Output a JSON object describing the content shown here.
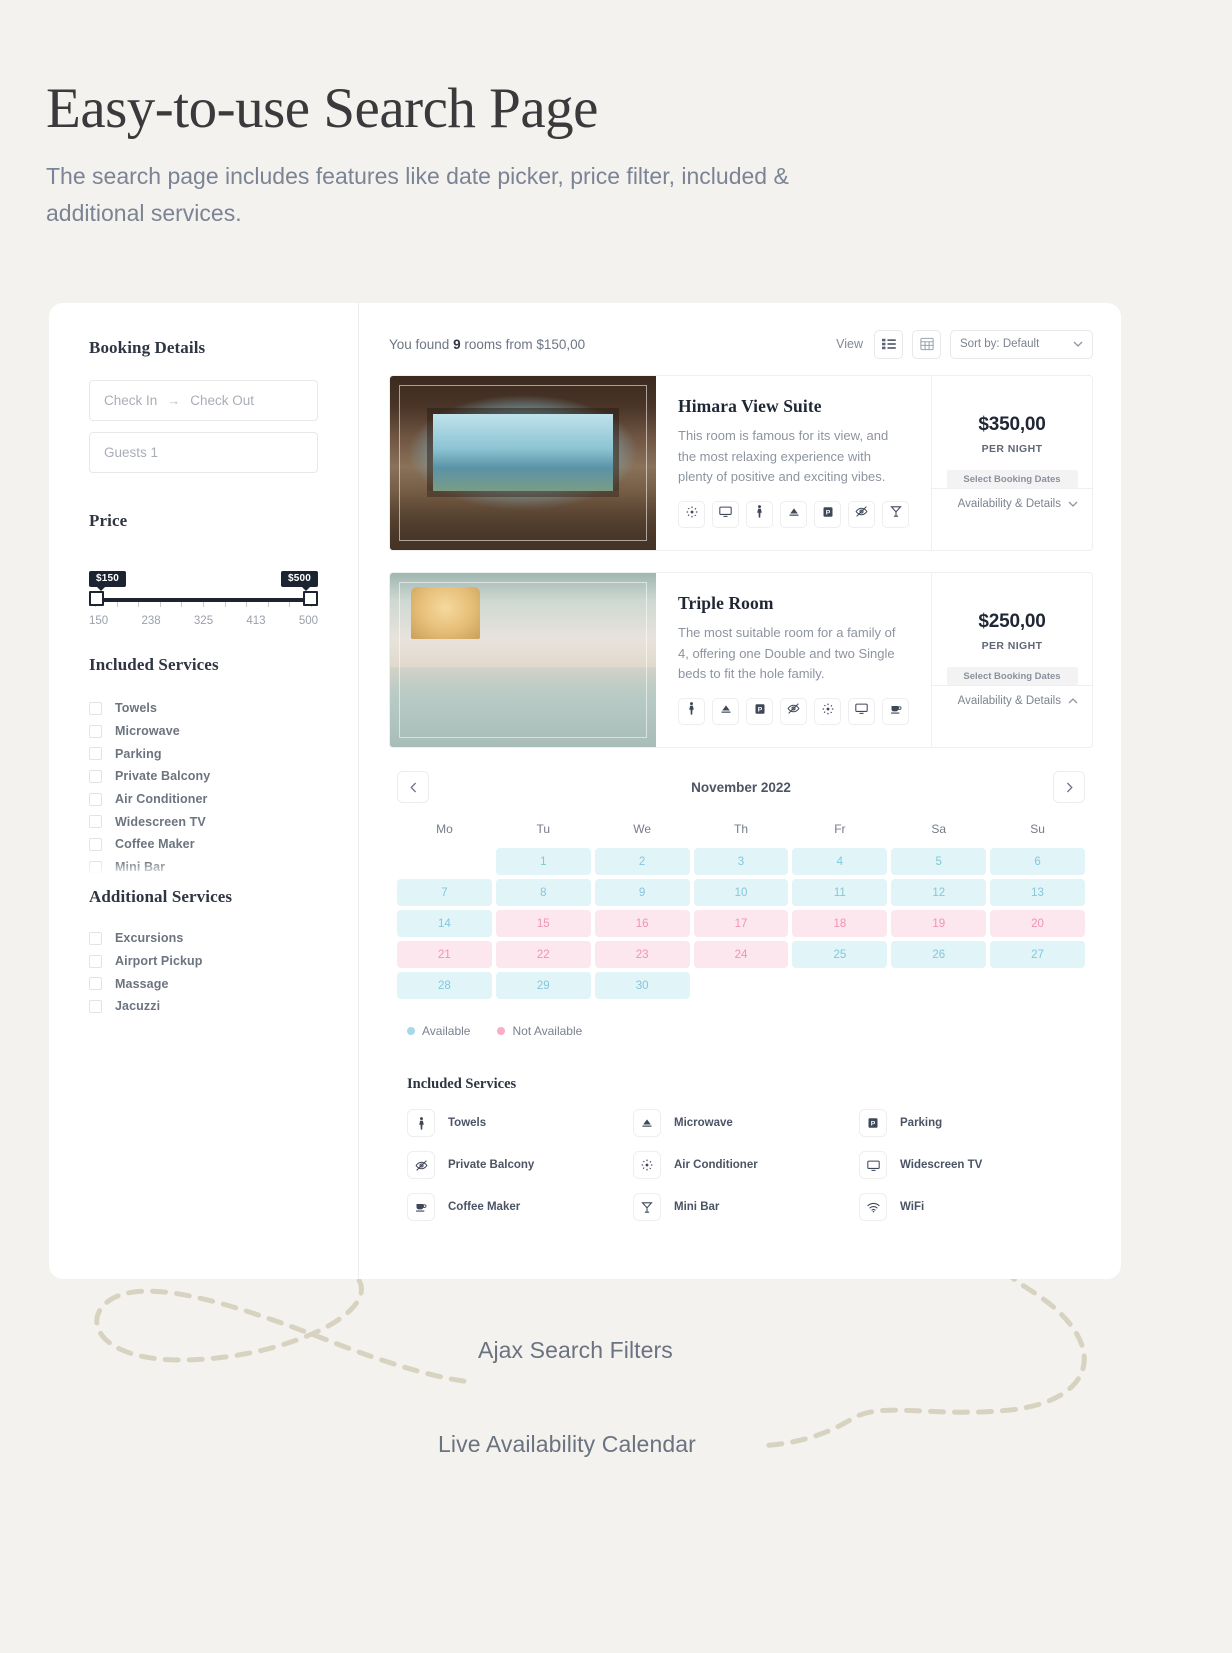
{
  "hero": {
    "title": "Easy-to-use Search Page",
    "subtitle": "The search page includes features like date picker, price filter, included & additional services."
  },
  "sidebar": {
    "booking_details_title": "Booking Details",
    "check_in_placeholder": "Check In",
    "check_out_placeholder": "Check Out",
    "arrow": "→",
    "guests_value": "Guests 1",
    "price_title": "Price",
    "price_min_bubble": "$150",
    "price_max_bubble": "$500",
    "scale": [
      "150",
      "238",
      "325",
      "413",
      "500"
    ],
    "included_title": "Included Services",
    "included_items": [
      "Towels",
      "Microwave",
      "Parking",
      "Private Balcony",
      "Air Conditioner",
      "Widescreen TV",
      "Coffee Maker",
      "Mini Bar"
    ],
    "additional_title": "Additional Services",
    "additional_items": [
      "Excursions",
      "Airport Pickup",
      "Massage",
      "Jacuzzi"
    ]
  },
  "toolbar": {
    "found_prefix": "You found ",
    "found_count": "9",
    "found_suffix": " rooms from $150,00",
    "view_label": "View",
    "sort_label": "Sort by: Default"
  },
  "rooms": [
    {
      "title": "Himara View Suite",
      "description": "This room is famous for its view, and the most relaxing experience with plenty of positive and exciting vibes.",
      "price": "$350,00",
      "per": "PER NIGHT",
      "cta": "Select Booking Dates",
      "availability_label": "Availability & Details",
      "amenities": [
        "air-conditioner",
        "widescreen-tv",
        "towels",
        "microwave",
        "parking",
        "private-balcony",
        "mini-bar"
      ]
    },
    {
      "title": "Triple Room",
      "description": "The most suitable room for a family of 4, offering one Double and two Single beds to fit the hole family.",
      "price": "$250,00",
      "per": "PER NIGHT",
      "cta": "Select Booking Dates",
      "availability_label": "Availability & Details",
      "amenities": [
        "towels",
        "microwave",
        "parking",
        "private-balcony",
        "air-conditioner",
        "widescreen-tv",
        "coffee-maker"
      ]
    }
  ],
  "calendar": {
    "month": "November 2022",
    "prev_icon": "chevron-left-icon",
    "next_icon": "chevron-right-icon",
    "weekdays": [
      "Mo",
      "Tu",
      "We",
      "Th",
      "Fr",
      "Sa",
      "Su"
    ],
    "weeks": [
      [
        null,
        {
          "d": "1",
          "s": "avail"
        },
        {
          "d": "2",
          "s": "avail"
        },
        {
          "d": "3",
          "s": "avail"
        },
        {
          "d": "4",
          "s": "avail"
        },
        {
          "d": "5",
          "s": "avail"
        },
        {
          "d": "6",
          "s": "avail"
        }
      ],
      [
        {
          "d": "7",
          "s": "avail"
        },
        {
          "d": "8",
          "s": "avail"
        },
        {
          "d": "9",
          "s": "avail"
        },
        {
          "d": "10",
          "s": "avail"
        },
        {
          "d": "11",
          "s": "avail"
        },
        {
          "d": "12",
          "s": "avail"
        },
        {
          "d": "13",
          "s": "avail"
        }
      ],
      [
        {
          "d": "14",
          "s": "avail"
        },
        {
          "d": "15",
          "s": "na"
        },
        {
          "d": "16",
          "s": "na"
        },
        {
          "d": "17",
          "s": "na"
        },
        {
          "d": "18",
          "s": "na"
        },
        {
          "d": "19",
          "s": "na"
        },
        {
          "d": "20",
          "s": "na"
        }
      ],
      [
        {
          "d": "21",
          "s": "na"
        },
        {
          "d": "22",
          "s": "na"
        },
        {
          "d": "23",
          "s": "na"
        },
        {
          "d": "24",
          "s": "na"
        },
        {
          "d": "25",
          "s": "avail"
        },
        {
          "d": "26",
          "s": "avail"
        },
        {
          "d": "27",
          "s": "avail"
        }
      ],
      [
        {
          "d": "28",
          "s": "avail"
        },
        {
          "d": "29",
          "s": "avail"
        },
        {
          "d": "30",
          "s": "avail"
        },
        null,
        null,
        null,
        null
      ]
    ],
    "legend_available": "Available",
    "legend_not_available": "Not Available",
    "color_available_bg": "#e1f4f8",
    "color_available_text": "#83c7dd",
    "color_not_available_bg": "#fde7ef",
    "color_not_available_text": "#f292b4"
  },
  "included_services_panel": {
    "title": "Included Services",
    "items": [
      {
        "label": "Towels",
        "icon": "towels-icon"
      },
      {
        "label": "Microwave",
        "icon": "microwave-icon"
      },
      {
        "label": "Parking",
        "icon": "parking-icon"
      },
      {
        "label": "Private Balcony",
        "icon": "private-balcony-icon"
      },
      {
        "label": "Air Conditioner",
        "icon": "air-conditioner-icon"
      },
      {
        "label": "Widescreen TV",
        "icon": "widescreen-tv-icon"
      },
      {
        "label": "Coffee Maker",
        "icon": "coffee-maker-icon"
      },
      {
        "label": "Mini Bar",
        "icon": "mini-bar-icon"
      },
      {
        "label": "WiFi",
        "icon": "wifi-icon"
      }
    ]
  },
  "annotations": {
    "ajax": "Ajax Search Filters",
    "calendar": "Live Availability Calendar"
  }
}
